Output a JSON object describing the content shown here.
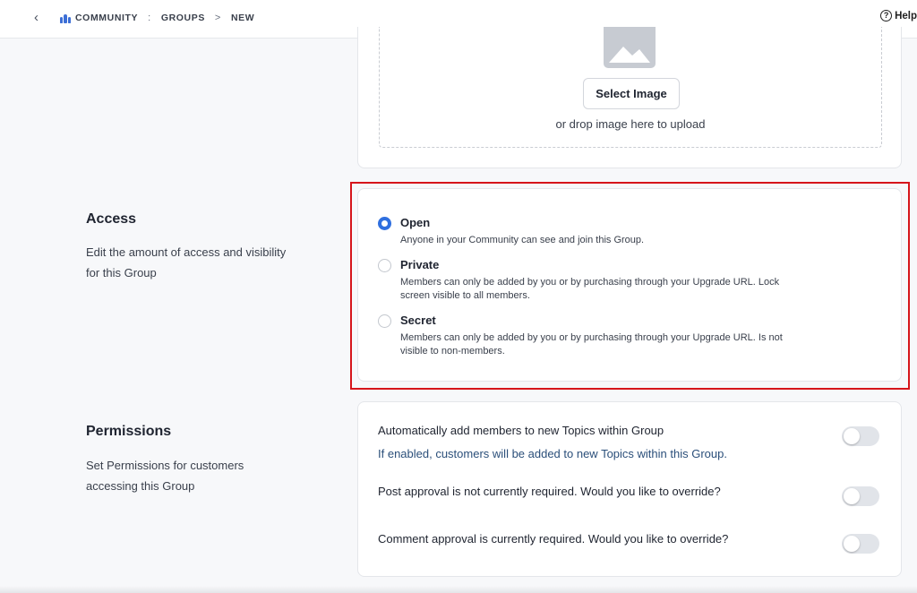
{
  "topbar": {
    "back_icon": "chevron-left-icon",
    "breadcrumb": {
      "community": "COMMUNITY",
      "sep1": ":",
      "groups": "GROUPS",
      "sep2": ">",
      "current": "NEW"
    },
    "help_label": "Help",
    "help_icon": "question-circle-icon"
  },
  "image_upload": {
    "icon": "image-placeholder-icon",
    "select_label": "Select Image",
    "drop_text": "or drop image here to upload"
  },
  "access": {
    "title": "Access",
    "description": "Edit the amount of access and visibility for this Group",
    "selected": "Open",
    "options": [
      {
        "label": "Open",
        "description": "Anyone in your Community can see and join this Group."
      },
      {
        "label": "Private",
        "description": "Members can only be added by you or by purchasing through your Upgrade URL. Lock screen visible to all members."
      },
      {
        "label": "Secret",
        "description": "Members can only be added by you or by purchasing through your Upgrade URL. Is not visible to non-members."
      }
    ]
  },
  "permissions": {
    "title": "Permissions",
    "description": "Set Permissions for customers accessing this Group",
    "items": [
      {
        "label": "Automatically add members to new Topics within Group",
        "hint": "If enabled, customers will be added to new Topics within this Group.",
        "enabled": false
      },
      {
        "label": "Post approval is not currently required. Would you like to override?",
        "enabled": false
      },
      {
        "label": "Comment approval is currently required. Would you like to override?",
        "enabled": false
      }
    ]
  },
  "colors": {
    "accent": "#2f6fdf",
    "highlight_border": "#d6151b",
    "hint_text": "#2b4f7a"
  }
}
